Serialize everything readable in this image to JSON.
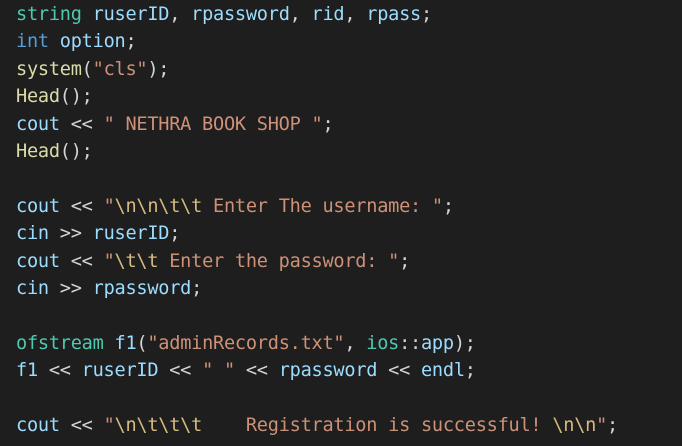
{
  "editor": {
    "language": "cpp",
    "colors": {
      "background": "#1e1e1e",
      "plain": "#d4d4d4",
      "type": "#4ec9b0",
      "keyword": "#569cd6",
      "variable": "#9cdcfe",
      "function": "#dcdcaa",
      "string": "#ce9178",
      "escape": "#d7ba7d"
    },
    "lines": [
      [
        [
          "type",
          "string"
        ],
        [
          "plain",
          " "
        ],
        [
          "var",
          "ruserID"
        ],
        [
          "plain",
          ", "
        ],
        [
          "var",
          "rpassword"
        ],
        [
          "plain",
          ", "
        ],
        [
          "var",
          "rid"
        ],
        [
          "plain",
          ", "
        ],
        [
          "var",
          "rpass"
        ],
        [
          "plain",
          ";"
        ]
      ],
      [
        [
          "kw",
          "int"
        ],
        [
          "plain",
          " "
        ],
        [
          "var",
          "option"
        ],
        [
          "plain",
          ";"
        ]
      ],
      [
        [
          "fn",
          "system"
        ],
        [
          "plain",
          "("
        ],
        [
          "str",
          "\"cls\""
        ],
        [
          "plain",
          ");"
        ]
      ],
      [
        [
          "fn",
          "Head"
        ],
        [
          "plain",
          "();"
        ]
      ],
      [
        [
          "var",
          "cout"
        ],
        [
          "plain",
          " << "
        ],
        [
          "str",
          "\" NETHRA BOOK SHOP \""
        ],
        [
          "plain",
          ";"
        ]
      ],
      [
        [
          "fn",
          "Head"
        ],
        [
          "plain",
          "();"
        ]
      ],
      [],
      [
        [
          "var",
          "cout"
        ],
        [
          "plain",
          " << "
        ],
        [
          "str",
          "\""
        ],
        [
          "esc",
          "\\n\\n\\t\\t"
        ],
        [
          "str",
          " Enter The username: \""
        ],
        [
          "plain",
          ";"
        ]
      ],
      [
        [
          "var",
          "cin"
        ],
        [
          "plain",
          " >> "
        ],
        [
          "var",
          "ruserID"
        ],
        [
          "plain",
          ";"
        ]
      ],
      [
        [
          "var",
          "cout"
        ],
        [
          "plain",
          " << "
        ],
        [
          "str",
          "\""
        ],
        [
          "esc",
          "\\t\\t"
        ],
        [
          "str",
          " Enter the password: \""
        ],
        [
          "plain",
          ";"
        ]
      ],
      [
        [
          "var",
          "cin"
        ],
        [
          "plain",
          " >> "
        ],
        [
          "var",
          "rpassword"
        ],
        [
          "plain",
          ";"
        ]
      ],
      [],
      [
        [
          "type",
          "ofstream"
        ],
        [
          "plain",
          " "
        ],
        [
          "var",
          "f1"
        ],
        [
          "plain",
          "("
        ],
        [
          "str",
          "\"adminRecords.txt\""
        ],
        [
          "plain",
          ", "
        ],
        [
          "type",
          "ios"
        ],
        [
          "plain",
          "::"
        ],
        [
          "var",
          "app"
        ],
        [
          "plain",
          ");"
        ]
      ],
      [
        [
          "var",
          "f1"
        ],
        [
          "plain",
          " << "
        ],
        [
          "var",
          "ruserID"
        ],
        [
          "plain",
          " << "
        ],
        [
          "str",
          "\" \""
        ],
        [
          "plain",
          " << "
        ],
        [
          "var",
          "rpassword"
        ],
        [
          "plain",
          " << "
        ],
        [
          "var",
          "endl"
        ],
        [
          "plain",
          ";"
        ]
      ],
      [],
      [
        [
          "var",
          "cout"
        ],
        [
          "plain",
          " << "
        ],
        [
          "str",
          "\""
        ],
        [
          "esc",
          "\\n\\t\\t\\t"
        ],
        [
          "str",
          "    Registration is successful! "
        ],
        [
          "esc",
          "\\n\\n"
        ],
        [
          "str",
          "\""
        ],
        [
          "plain",
          ";"
        ]
      ]
    ]
  }
}
